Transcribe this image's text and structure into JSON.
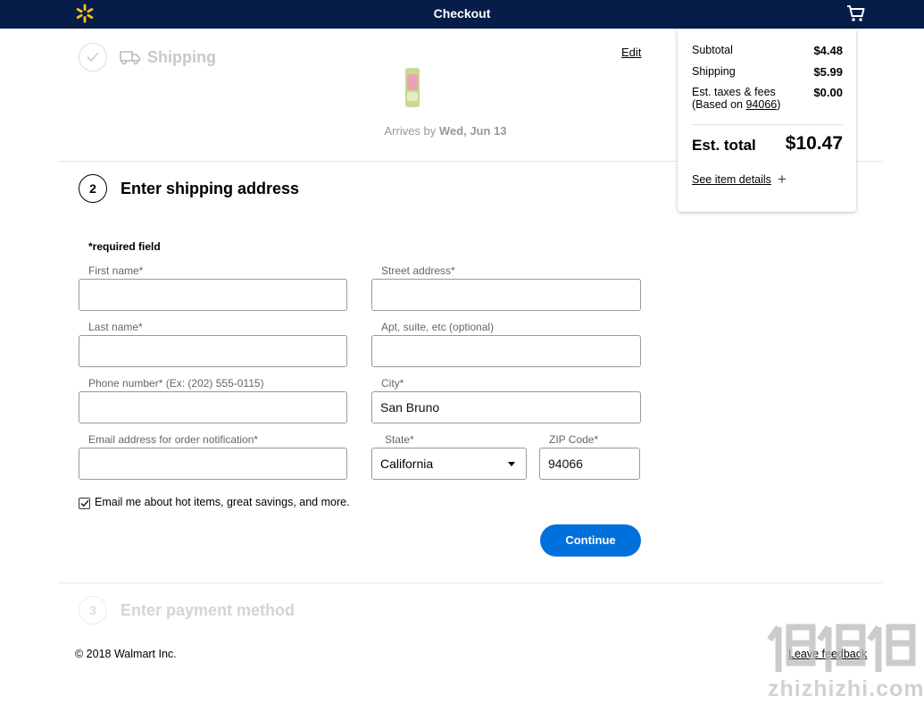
{
  "header": {
    "title": "Checkout",
    "logo_icon": "walmart-spark-icon",
    "cart_icon": "cart-icon",
    "bg_color": "#071d49",
    "spark_color": "#ffc220"
  },
  "step1": {
    "title": "Shipping",
    "edit_label": "Edit",
    "arrives_prefix": "Arrives by ",
    "arrives_date": "Wed, Jun 13"
  },
  "step2": {
    "number": "2",
    "title": "Enter shipping address",
    "required_note": "*required field",
    "fields": {
      "first_name": {
        "label": "First name*",
        "value": ""
      },
      "last_name": {
        "label": "Last name*",
        "value": ""
      },
      "phone": {
        "label": "Phone number* (Ex: (202) 555-0115)",
        "value": ""
      },
      "email": {
        "label": "Email address for order notification*",
        "value": ""
      },
      "street": {
        "label": "Street address*",
        "value": ""
      },
      "apt": {
        "label": "Apt, suite, etc (optional)",
        "value": ""
      },
      "city": {
        "label": "City*",
        "value": "San Bruno"
      },
      "state": {
        "label": "State*",
        "value": "California"
      },
      "zip": {
        "label": "ZIP Code*",
        "value": "94066"
      }
    },
    "email_opt_in": {
      "label": "Email me about hot items, great savings, and more.",
      "checked": true
    },
    "continue_label": "Continue",
    "continue_color": "#0071dc"
  },
  "step3": {
    "number": "3",
    "title": "Enter payment method"
  },
  "footer": {
    "copyright": "© 2018 Walmart Inc.",
    "feedback": "Leave feedback"
  },
  "summary": {
    "subtotal_label": "Subtotal",
    "subtotal_value": "$4.48",
    "shipping_label": "Shipping",
    "shipping_value": "$5.99",
    "taxes_label": "Est. taxes & fees",
    "taxes_value": "$0.00",
    "based_on_prefix": "(Based on ",
    "based_on_zip": "94066",
    "based_on_suffix": ")",
    "total_label": "Est. total",
    "total_value": "$10.47",
    "details_link": "See item details"
  },
  "watermark": {
    "text": "zhizhizhi.com"
  }
}
